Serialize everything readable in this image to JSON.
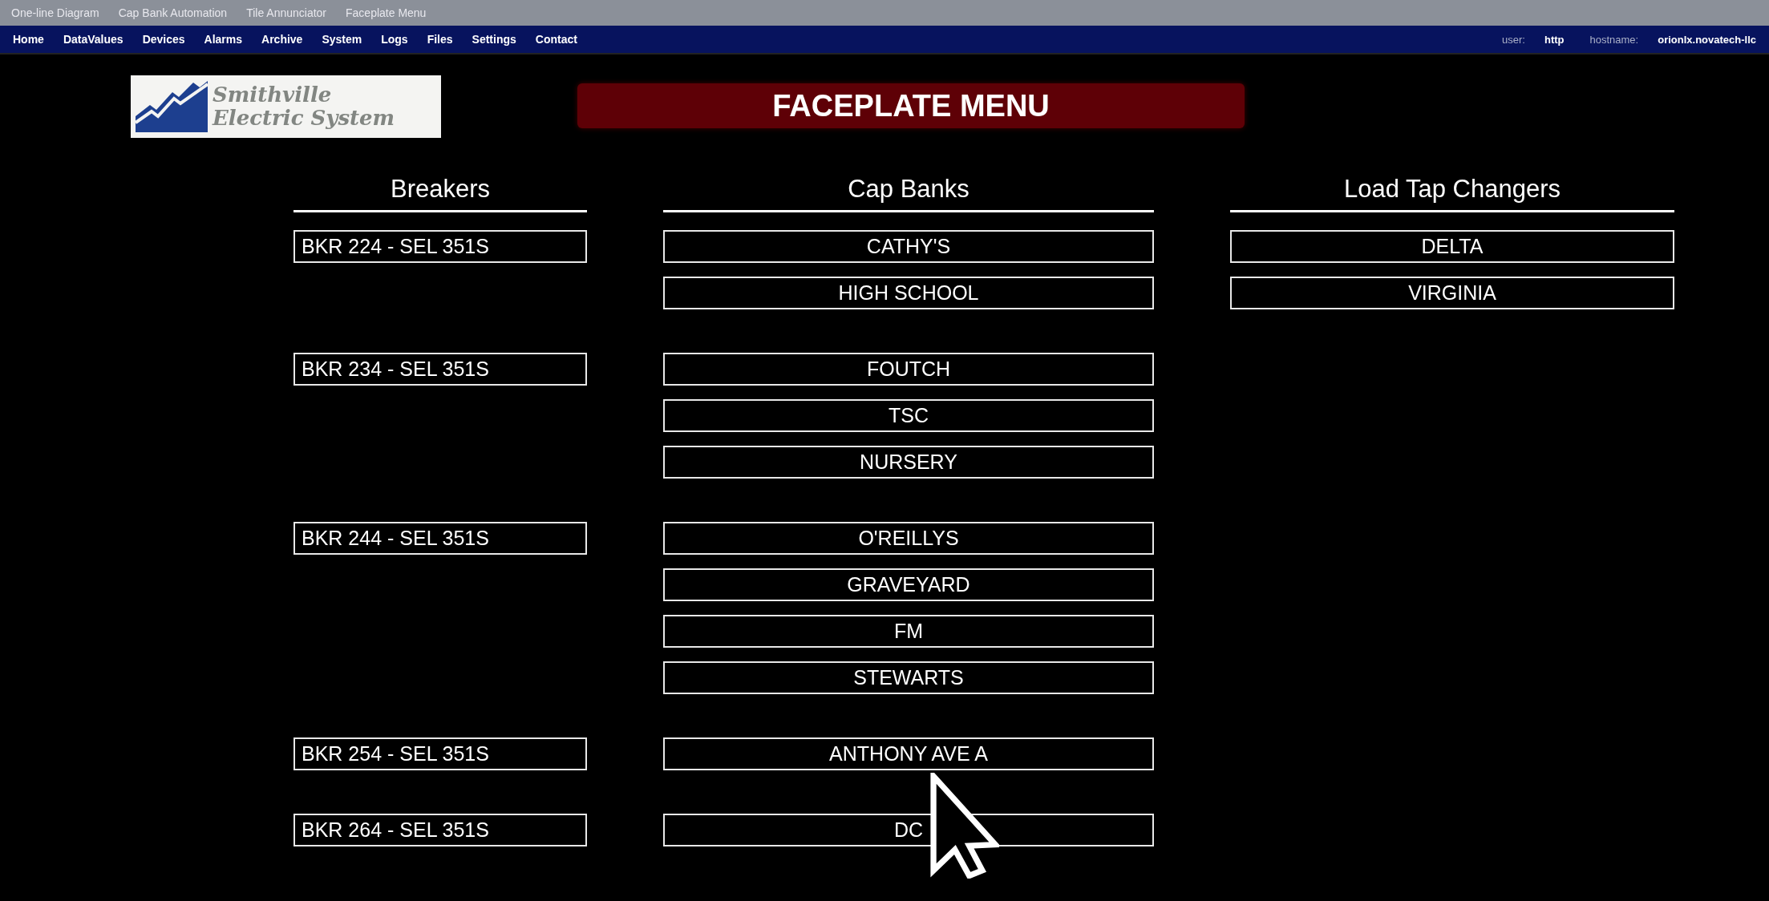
{
  "top_menu": [
    "One-line Diagram",
    "Cap Bank Automation",
    "Tile Annunciator",
    "Faceplate Menu"
  ],
  "nav": [
    "Home",
    "DataValues",
    "Devices",
    "Alarms",
    "Archive",
    "System",
    "Logs",
    "Files",
    "Settings",
    "Contact"
  ],
  "session": {
    "user_label": "user:",
    "user": "http",
    "hostname_label": "hostname:",
    "hostname": "orionlx.novatech-llc"
  },
  "logo": {
    "line_1": "Smithville",
    "line_2": "Electric System"
  },
  "title": "FACEPLATE MENU",
  "headers": [
    "Breakers",
    "Cap Banks",
    "Load Tap Changers"
  ],
  "groups": [
    {
      "breaker": "BKR 224 - SEL 351S",
      "cap_banks": [
        "CATHY'S",
        "HIGH SCHOOL"
      ]
    },
    {
      "breaker": "BKR 234 - SEL 351S",
      "cap_banks": [
        "FOUTCH",
        "TSC",
        "NURSERY"
      ]
    },
    {
      "breaker": "BKR 244 - SEL 351S",
      "cap_banks": [
        "O'REILLYS",
        "GRAVEYARD",
        "FM",
        "STEWARTS"
      ]
    },
    {
      "breaker": "BKR 254 - SEL 351S",
      "cap_banks": [
        "ANTHONY AVE A"
      ]
    },
    {
      "breaker": "BKR 264 - SEL 351S",
      "cap_banks": [
        "DC"
      ]
    }
  ],
  "load_tap_changers": [
    "DELTA",
    "VIRGINIA"
  ]
}
